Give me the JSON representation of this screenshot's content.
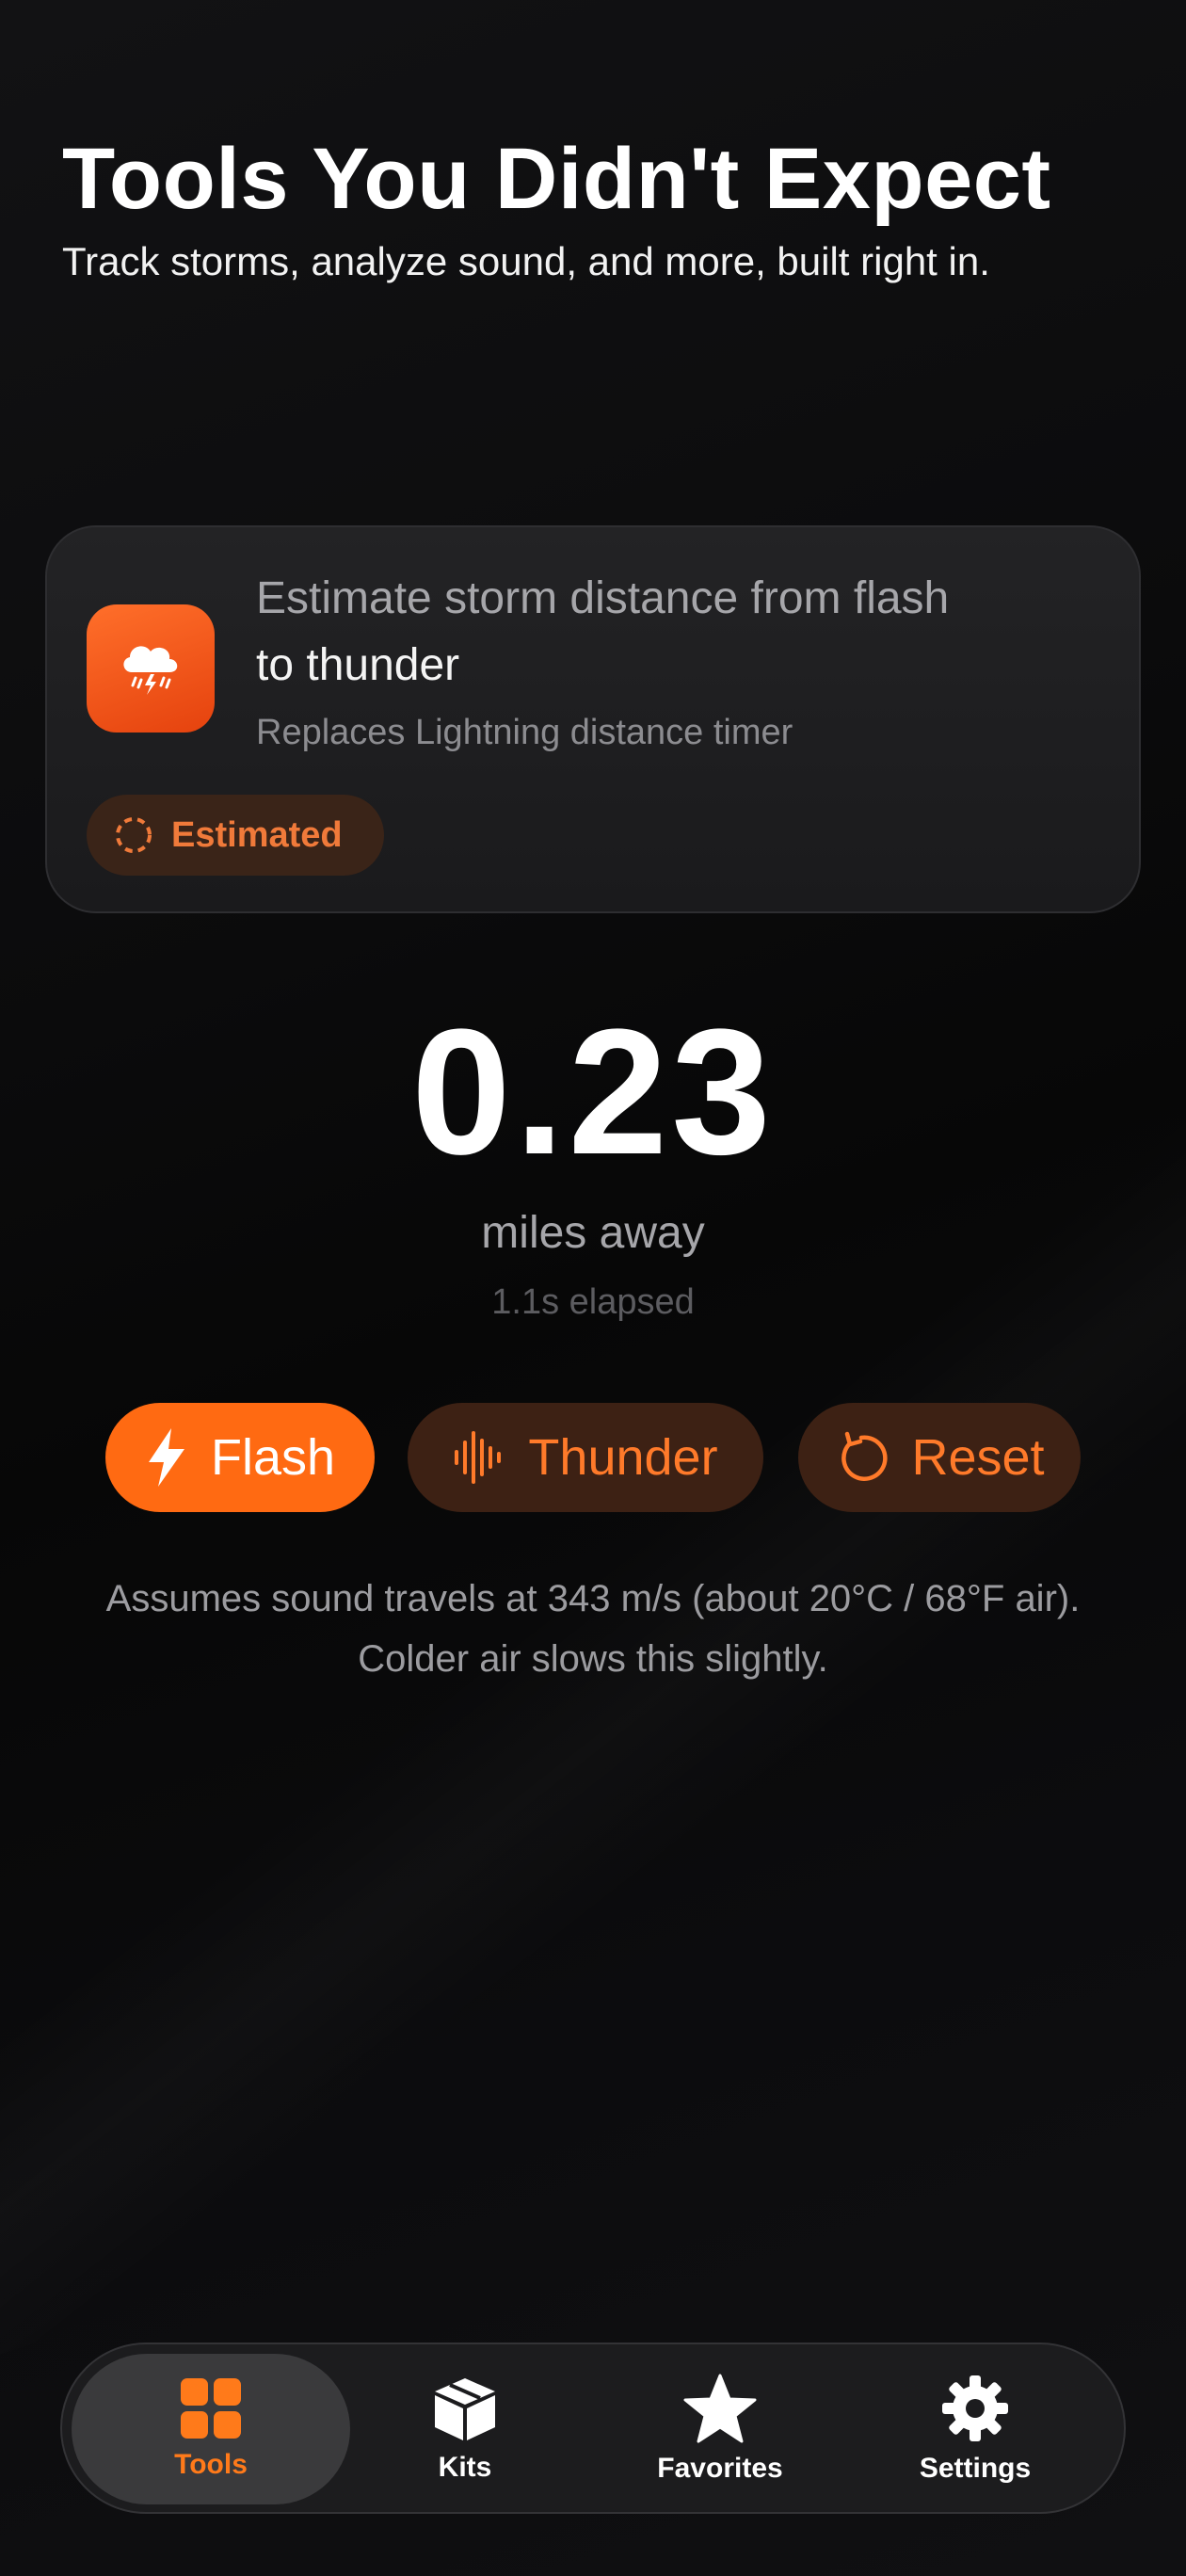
{
  "header": {
    "title": "Tools You Didn't Expect",
    "subtitle": "Track storms, analyze sound, and more, built right in."
  },
  "card": {
    "icon": "cloud-lightning-rain-icon",
    "line1": "Estimate storm distance from flash",
    "line2": "to thunder",
    "replaces": "Replaces Lightning distance timer",
    "badge": {
      "icon": "dashed-circle-icon",
      "label": "Estimated"
    }
  },
  "readout": {
    "distance": "0.23",
    "unit": "miles away",
    "elapsed": "1.1s elapsed"
  },
  "buttons": {
    "flash": {
      "label": "Flash",
      "icon": "bolt-icon"
    },
    "thunder": {
      "label": "Thunder",
      "icon": "waveform-icon"
    },
    "reset": {
      "label": "Reset",
      "icon": "reset-icon"
    }
  },
  "note": "Assumes sound travels at 343 m/s (about 20°C / 68°F air). Colder air slows this slightly.",
  "tabbar": {
    "tabs": [
      {
        "label": "Tools",
        "icon": "grid-icon",
        "active": true
      },
      {
        "label": "Kits",
        "icon": "box-icon",
        "active": false
      },
      {
        "label": "Favorites",
        "icon": "star-icon",
        "active": false
      },
      {
        "label": "Settings",
        "icon": "gear-icon",
        "active": false
      }
    ]
  },
  "colors": {
    "accent": "#ff6a12",
    "accent_text": "#ff7a2a",
    "background": "#0d0d0f",
    "card": "#1f1f21"
  }
}
